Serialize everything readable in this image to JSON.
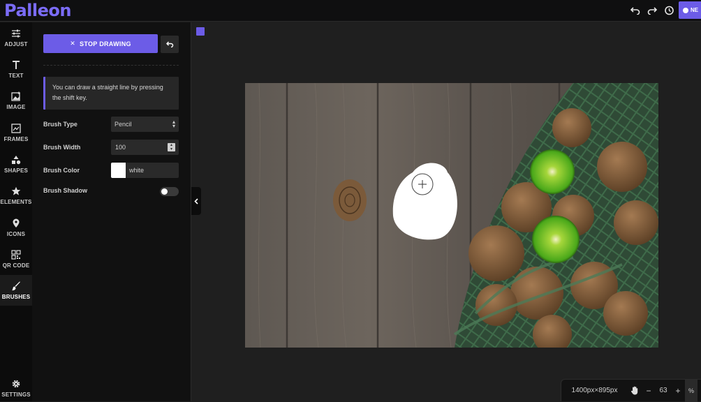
{
  "app": {
    "logo": "Palleon",
    "new_button": "NE"
  },
  "nav": {
    "items": [
      {
        "label": "ADJUST",
        "icon": "sliders-icon"
      },
      {
        "label": "TEXT",
        "icon": "text-icon"
      },
      {
        "label": "IMAGE",
        "icon": "image-icon"
      },
      {
        "label": "FRAMES",
        "icon": "frames-icon"
      },
      {
        "label": "SHAPES",
        "icon": "shapes-icon"
      },
      {
        "label": "ELEMENTS",
        "icon": "star-icon"
      },
      {
        "label": "ICONS",
        "icon": "location-pin-icon"
      },
      {
        "label": "QR CODE",
        "icon": "qr-code-icon"
      },
      {
        "label": "BRUSHES",
        "icon": "brush-icon"
      }
    ],
    "settings": {
      "label": "SETTINGS",
      "icon": "gear-icon"
    }
  },
  "panel": {
    "stop_label": "STOP DRAWING",
    "hint": "You can draw a straight line by pressing the shift key.",
    "brush_type_label": "Brush Type",
    "brush_type_value": "Pencil",
    "brush_width_label": "Brush Width",
    "brush_width_value": "100",
    "brush_color_label": "Brush Color",
    "brush_color_value": "white",
    "brush_color_hex": "#ffffff",
    "brush_shadow_label": "Brush Shadow",
    "brush_shadow_on": false
  },
  "status": {
    "dimensions": "1400px×895px",
    "zoom_minus": "−",
    "zoom_value": "63",
    "zoom_plus": "+",
    "zoom_unit": "%"
  },
  "colors": {
    "accent": "#6c5ce7",
    "background": "#1f1f1f",
    "panel": "#111111"
  }
}
